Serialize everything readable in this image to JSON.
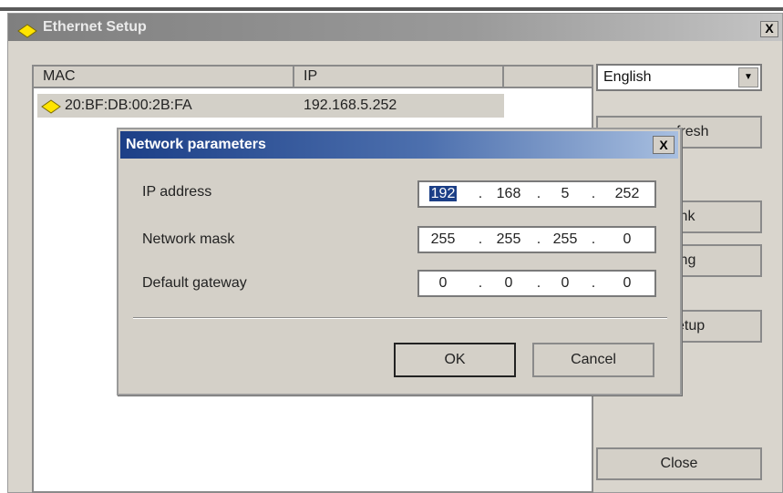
{
  "main_window": {
    "title": "Ethernet Setup",
    "close_glyph": "X",
    "icon": "diamond-icon"
  },
  "device_list": {
    "columns": [
      "MAC",
      "IP"
    ],
    "rows": [
      {
        "mac": "20:BF:DB:00:2B:FA",
        "ip": "192.168.5.252"
      }
    ]
  },
  "sidebar": {
    "language_value": "English",
    "buttons": [
      {
        "visible_text": "fresh"
      },
      {
        "visible_text": "ink"
      },
      {
        "visible_text": "ing"
      },
      {
        "visible_text": "etup"
      }
    ],
    "close_label": "Close"
  },
  "dialog": {
    "title": "Network parameters",
    "close_glyph": "X",
    "fields": [
      {
        "label": "IP address",
        "octets": [
          "192",
          "168",
          "5",
          "252"
        ]
      },
      {
        "label": "Network mask",
        "octets": [
          "255",
          "255",
          "255",
          "0"
        ]
      },
      {
        "label": "Default gateway",
        "octets": [
          "0",
          "0",
          "0",
          "0"
        ]
      }
    ],
    "ok_label": "OK",
    "cancel_label": "Cancel"
  },
  "colors": {
    "dialog_title_bg": "#1c3f87",
    "main_title_bg": "#8c8c8c",
    "window_bg": "#d4d0c8",
    "diamond_fill": "#ffe400"
  }
}
